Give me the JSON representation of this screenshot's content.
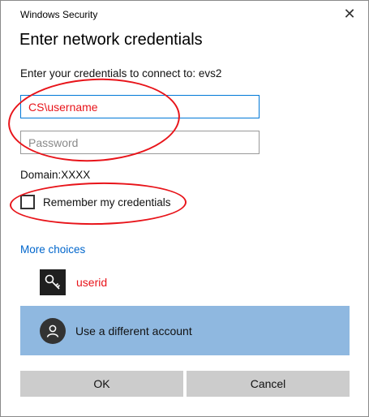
{
  "window": {
    "title": "Windows Security",
    "close_symbol": "✕"
  },
  "header": {
    "title": "Enter network credentials"
  },
  "prompt": {
    "text": "Enter your credentials to connect to: evs2"
  },
  "form": {
    "username_value": "CS\\username",
    "password_placeholder": "Password",
    "domain_label": "Domain:",
    "domain_value": "XXXX",
    "remember_label": "Remember my credentials",
    "remember_checked": false
  },
  "more_choices": {
    "label": "More choices",
    "accounts": [
      {
        "label": "userid",
        "icon": "key-icon"
      },
      {
        "label": "Use a different account",
        "icon": "person-icon"
      }
    ]
  },
  "buttons": {
    "ok": "OK",
    "cancel": "Cancel"
  },
  "colors": {
    "accent": "#0066cc",
    "annotation": "#e8141a",
    "selected": "#8fb8e0",
    "button": "#cccccc"
  }
}
